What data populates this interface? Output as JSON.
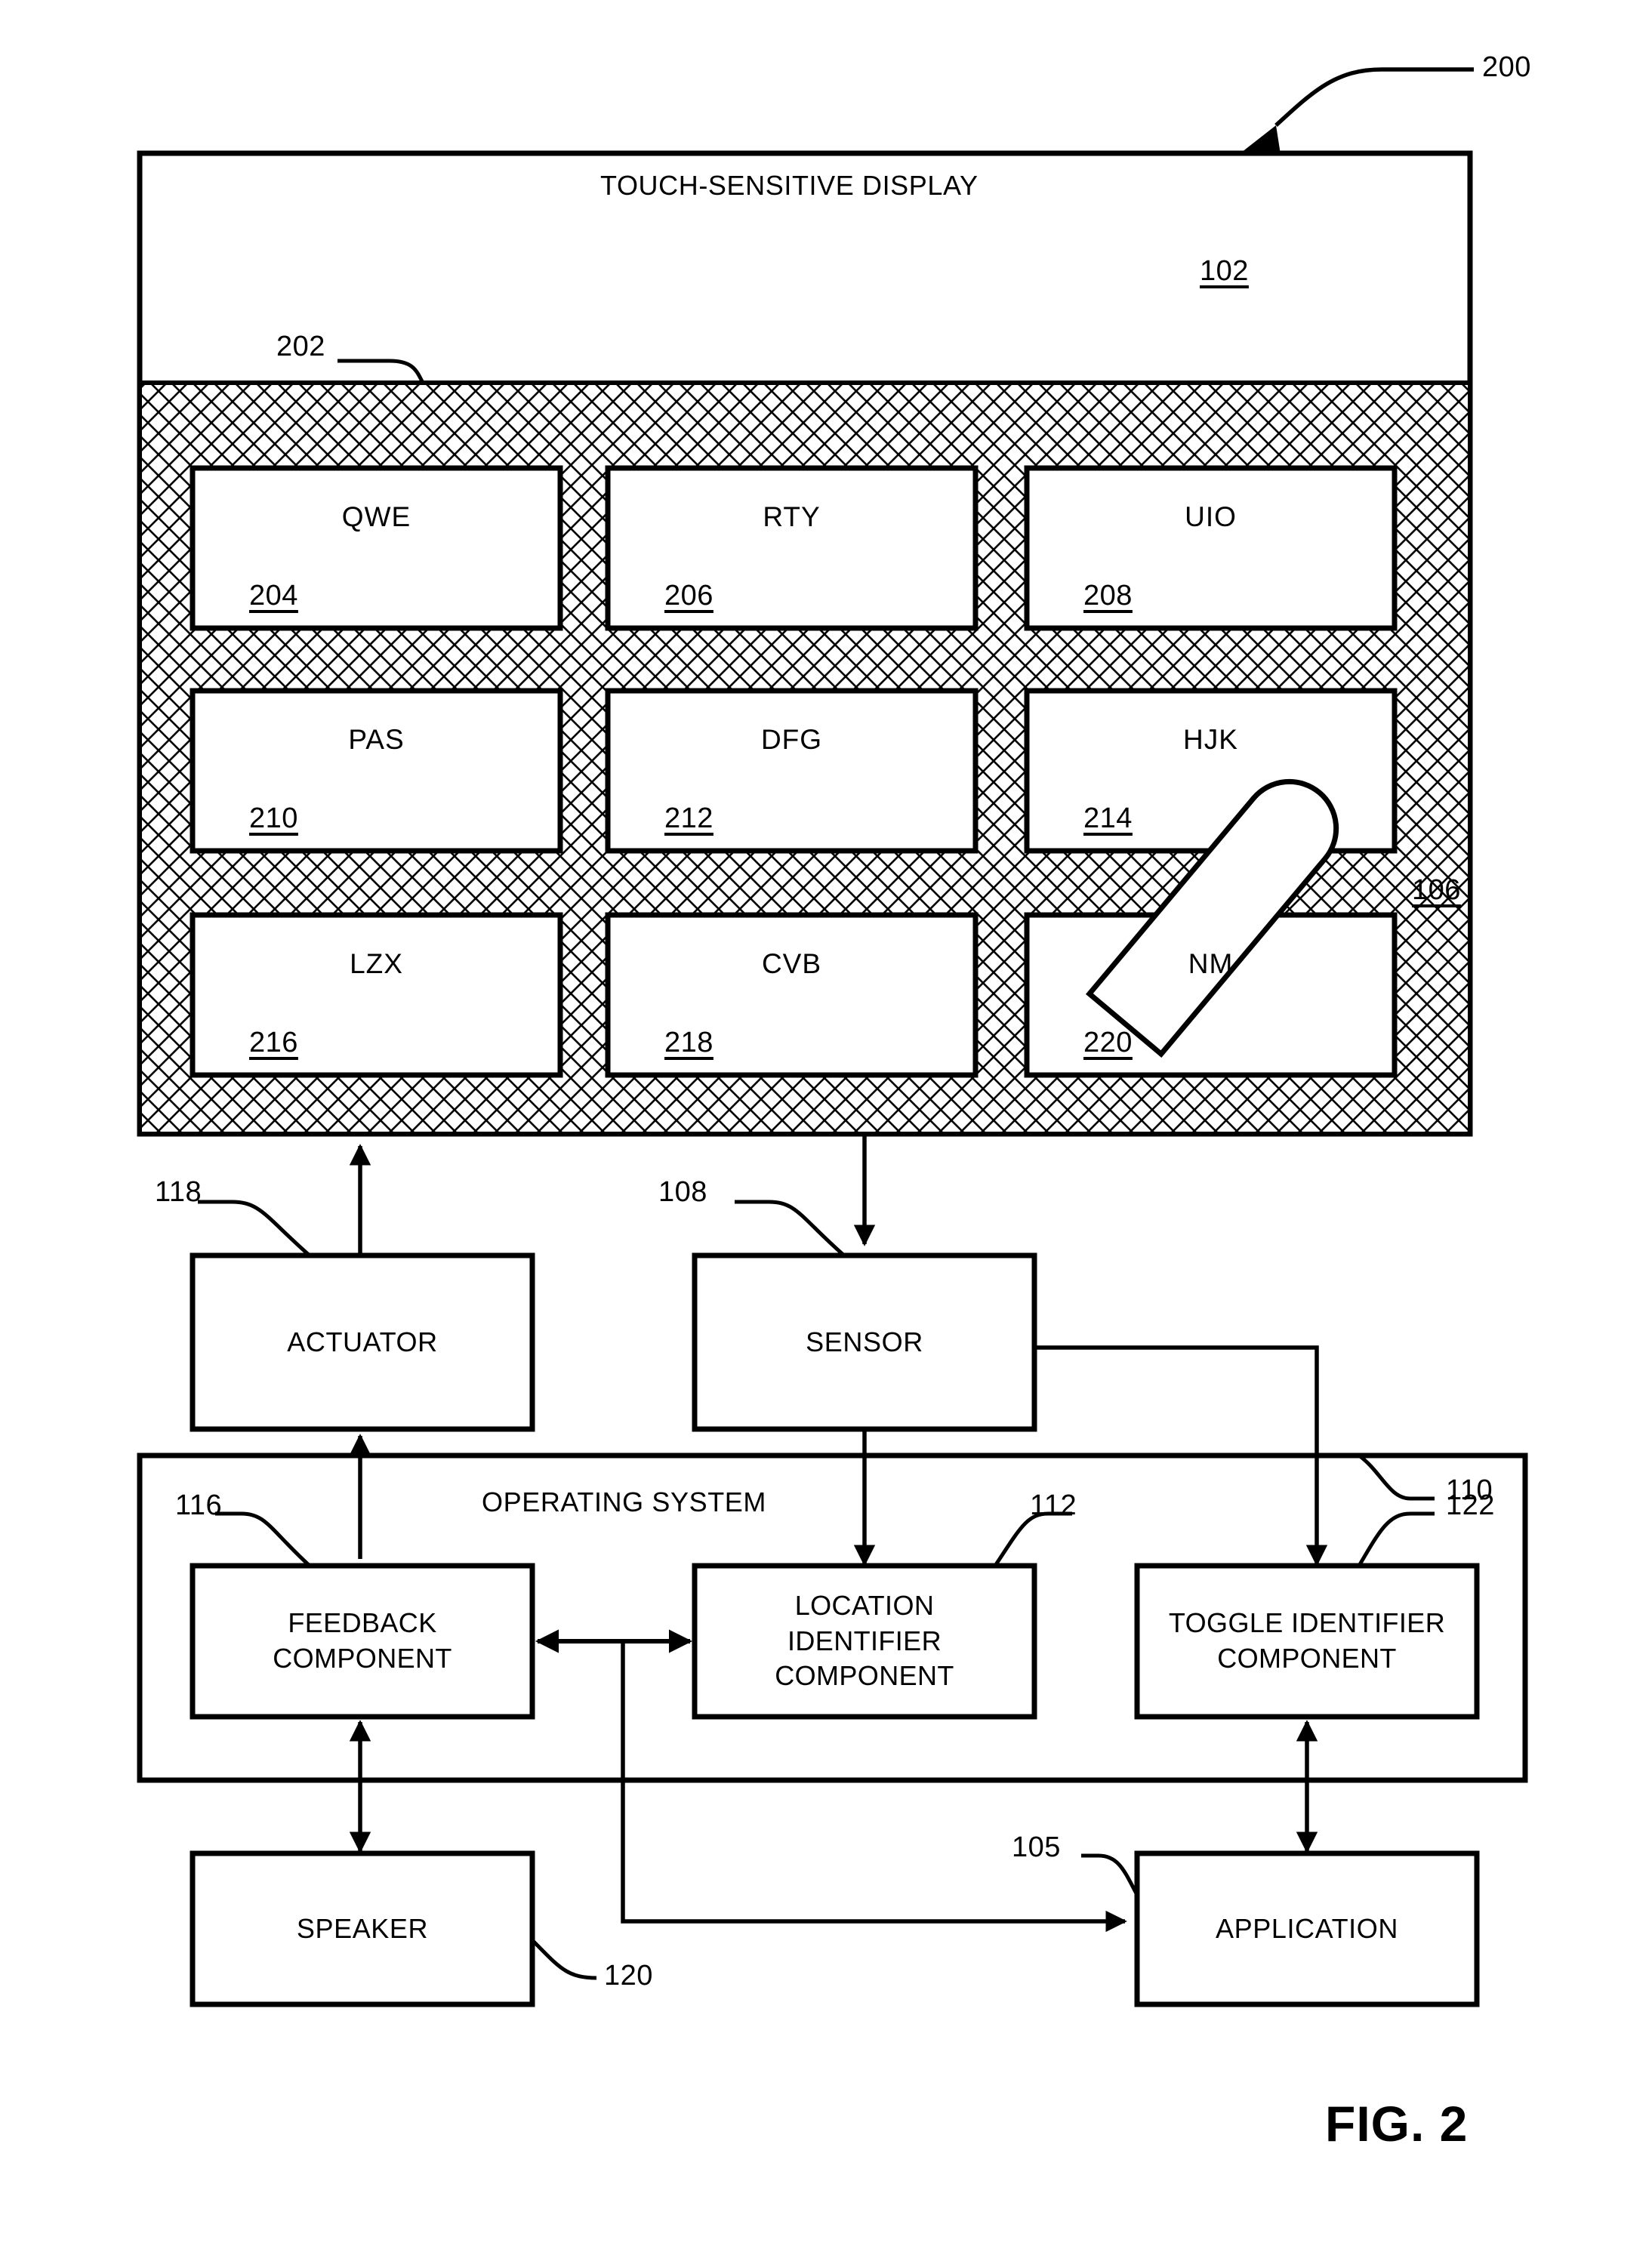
{
  "figure": {
    "caption": "FIG. 2",
    "system_ref": "200"
  },
  "display": {
    "title": "TOUCH-SENSITIVE DISPLAY",
    "ref": "102",
    "keyboard_region_ref": "202",
    "finger_ref": "106"
  },
  "keys": [
    {
      "label": "QWE",
      "ref": "204"
    },
    {
      "label": "RTY",
      "ref": "206"
    },
    {
      "label": "UIO",
      "ref": "208"
    },
    {
      "label": "PAS",
      "ref": "210"
    },
    {
      "label": "DFG",
      "ref": "212"
    },
    {
      "label": "HJK",
      "ref": "214"
    },
    {
      "label": "LZX",
      "ref": "216"
    },
    {
      "label": "CVB",
      "ref": "218"
    },
    {
      "label": "NM",
      "ref": "220"
    }
  ],
  "blocks": {
    "actuator": {
      "label": "ACTUATOR",
      "ref": "118"
    },
    "sensor": {
      "label": "SENSOR",
      "ref": "108"
    },
    "os": {
      "label": "OPERATING SYSTEM",
      "ref": "110"
    },
    "feedback": {
      "line1": "FEEDBACK",
      "line2": "COMPONENT",
      "ref": "116"
    },
    "location": {
      "line1": "LOCATION",
      "line2": "IDENTIFIER",
      "line3": "COMPONENT",
      "ref": "112"
    },
    "toggle": {
      "line1": "TOGGLE IDENTIFIER",
      "line2": "COMPONENT",
      "ref": "122"
    },
    "speaker": {
      "label": "SPEAKER",
      "ref": "120"
    },
    "application": {
      "label": "APPLICATION",
      "ref": "105"
    }
  },
  "style": {
    "ink": "#000000",
    "paper": "#ffffff"
  }
}
